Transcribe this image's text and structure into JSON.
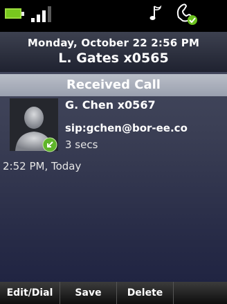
{
  "status_bar": {
    "battery_icon": "battery-icon",
    "signal_icon": "signal-strength-icon",
    "ringtone_icon": "music-note-icon",
    "voicemail_icon": "message-waiting-icon",
    "colors": {
      "battery": "#78c81e",
      "signal": "#ffffff"
    }
  },
  "header": {
    "datetime": "Monday, October 22 2:56 PM",
    "line": "L. Gates x0565"
  },
  "title": "Received Call",
  "call": {
    "avatar_icon": "contact-avatar-icon",
    "status_icon": "received-call-icon",
    "name": "G. Chen x0567",
    "uri": "sip:gchen@bor-ee.co",
    "duration": "3 secs",
    "timestamp": "2:52 PM, Today"
  },
  "softkeys": {
    "edit_dial": "Edit/Dial",
    "save": "Save",
    "delete": "Delete"
  }
}
